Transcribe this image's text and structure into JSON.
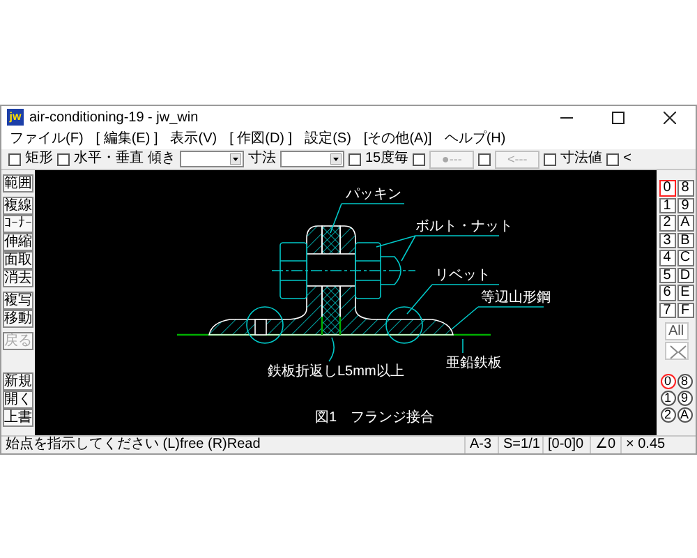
{
  "window": {
    "logo": "jw",
    "title": "air-conditioning-19 - jw_win"
  },
  "menu": [
    "ファイル(F)",
    "[ 編集(E) ]",
    "表示(V)",
    "[ 作図(D) ]",
    "設定(S)",
    "[その他(A)]",
    "ヘルプ(H)"
  ],
  "toolbar": [
    {
      "kind": "checkbox",
      "label": "矩形",
      "checked": false
    },
    {
      "kind": "checkbox",
      "label": "水平・垂直",
      "checked": false
    },
    {
      "kind": "label",
      "label": "傾き"
    },
    {
      "kind": "combo"
    },
    {
      "kind": "label",
      "label": "寸法"
    },
    {
      "kind": "combo"
    },
    {
      "kind": "checkbox",
      "label": "15度毎",
      "checked": false
    },
    {
      "kind": "checkbox",
      "checked": false
    },
    {
      "kind": "button",
      "label": "●---",
      "disabled": true
    },
    {
      "kind": "checkbox",
      "checked": false
    },
    {
      "kind": "button",
      "label": "<---",
      "disabled": true
    },
    {
      "kind": "checkbox",
      "label": "寸法値",
      "checked": false
    },
    {
      "kind": "checkbox",
      "label": "<",
      "checked": false
    }
  ],
  "tool_groups": [
    [
      {
        "label": "範囲",
        "disabled": false
      }
    ],
    [
      {
        "label": "複線",
        "disabled": false
      },
      {
        "label": "ｺｰﾅｰ",
        "disabled": false
      },
      {
        "label": "伸縮",
        "disabled": false
      },
      {
        "label": "面取",
        "disabled": false
      },
      {
        "label": "消去",
        "disabled": false
      }
    ],
    [
      {
        "label": "複写",
        "disabled": false
      },
      {
        "label": "移動",
        "disabled": false
      }
    ],
    [
      {
        "label": "戻る",
        "disabled": true
      }
    ],
    [
      {
        "label": "新規",
        "disabled": false
      },
      {
        "label": "開く",
        "disabled": false
      },
      {
        "label": "上書",
        "disabled": false
      }
    ]
  ],
  "layers": [
    {
      "label": "0",
      "selected": true
    },
    {
      "label": "8",
      "selected": false
    },
    {
      "label": "1",
      "selected": false
    },
    {
      "label": "9",
      "selected": false
    },
    {
      "label": "2",
      "selected": false
    },
    {
      "label": "A",
      "selected": false
    },
    {
      "label": "3",
      "selected": false
    },
    {
      "label": "B",
      "selected": false
    },
    {
      "label": "4",
      "selected": false
    },
    {
      "label": "C",
      "selected": false
    },
    {
      "label": "5",
      "selected": false
    },
    {
      "label": "D",
      "selected": false
    },
    {
      "label": "6",
      "selected": false
    },
    {
      "label": "E",
      "selected": false
    },
    {
      "label": "7",
      "selected": false
    },
    {
      "label": "F",
      "selected": false
    }
  ],
  "layer_all": "All",
  "layer_groups": [
    {
      "label": "0",
      "selected": true
    },
    {
      "label": "8",
      "selected": false
    },
    {
      "label": "1",
      "selected": false
    },
    {
      "label": "9",
      "selected": false
    },
    {
      "label": "2",
      "selected": false
    },
    {
      "label": "A",
      "selected": false
    }
  ],
  "drawing": {
    "labels": [
      "パッキン",
      "ボルト・ナット",
      "リベット",
      "等辺山形鋼",
      "鉄板折返しL5mm以上",
      "亜鉛鉄板"
    ],
    "caption": "図1　フランジ接合"
  },
  "status_bar": {
    "message": "始点を指示してください (L)free (R)Read",
    "fields": [
      "A-3",
      "S=1/1",
      "[0-0]0",
      "∠0",
      "× 0.45"
    ]
  }
}
